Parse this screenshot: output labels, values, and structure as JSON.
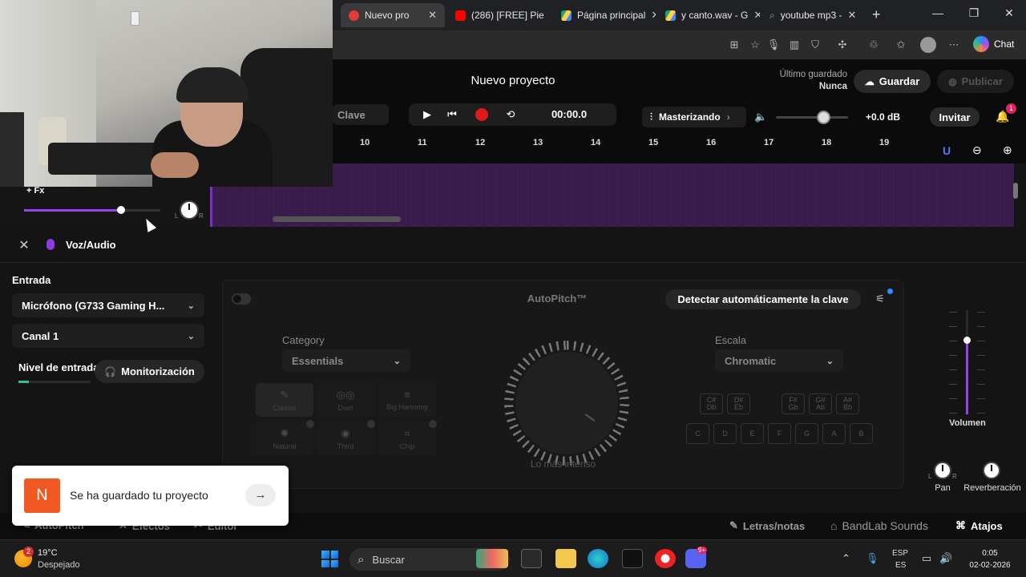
{
  "browser": {
    "tabs": [
      {
        "title": "Nuevo pro",
        "active": true
      },
      {
        "title": "(286) [FREE] Pie"
      },
      {
        "title": "Página principal"
      },
      {
        "title": "y canto.wav - G"
      },
      {
        "title": "youtube mp3 -"
      }
    ],
    "new_tab": "+",
    "chat_label": "Chat",
    "window": {
      "minimize": "—",
      "maximize": "❐",
      "close": "✕"
    }
  },
  "header": {
    "project_title": "Nuevo proyecto",
    "last_saved_label": "Último guardado",
    "last_saved_value": "Nunca",
    "save_label": "Guardar",
    "publish_label": "Publicar"
  },
  "transport": {
    "key_label": "Clave",
    "time": "00:00.0",
    "mastering_label": "Masterizando",
    "master_db": "+0.0 dB",
    "invite_label": "Invitar",
    "notifications_count": "1"
  },
  "ruler": {
    "ticks": [
      "10",
      "11",
      "12",
      "13",
      "14",
      "15",
      "16",
      "17",
      "18",
      "19"
    ]
  },
  "track": {
    "fx_label": "+ Fx",
    "knob_left": "L",
    "knob_right": "R"
  },
  "panel": {
    "title": "Voz/Audio",
    "input_label": "Entrada",
    "input_device": "Micrófono (G733 Gaming H...",
    "channel": "Canal 1",
    "input_level_label": "Nivel de entrada",
    "monitor_label": "Monitorización"
  },
  "autopitch": {
    "title": "AutoPitch™",
    "detect_key_label": "Detectar automáticamente la clave",
    "category_label": "Category",
    "category_value": "Essentials",
    "scale_label": "Escala",
    "scale_value": "Chromatic",
    "presets": [
      "Classic",
      "Duet",
      "Big Harmony",
      "Natural",
      "Third",
      "Chip"
    ],
    "dial_label": "Lo más intenso",
    "sharp_keys": [
      "C#\nDb",
      "D#\nEb",
      "F#\nGb",
      "G#\nAb",
      "A#\nBb"
    ],
    "natural_keys": [
      "C",
      "D",
      "E",
      "F",
      "G",
      "A",
      "B"
    ]
  },
  "mixer": {
    "volume_label": "Volumen",
    "pan_label": "Pan",
    "reverb_label": "Reverberación",
    "pan_left": "L",
    "pan_right": "R"
  },
  "bottom_bar": {
    "tabs": [
      "AutoPitch",
      "Efectos",
      "Editor"
    ],
    "lyrics_label": "Letras/notas",
    "sounds_label": "BandLab Sounds",
    "shortcuts_label": "Atajos"
  },
  "toast": {
    "logo": "N",
    "message": "Se ha guardado tu proyecto",
    "action": "→"
  },
  "taskbar": {
    "weather_badge": "2",
    "temperature": "19°C",
    "condition": "Despejado",
    "search_placeholder": "Buscar",
    "lang1": "ESP",
    "lang2": "ES",
    "time": "0:05",
    "date": "02-02-2026",
    "discord_badge": "9+"
  },
  "colors": {
    "accent": "#9c3ff0",
    "record": "#e2191a",
    "brand": "#f05a22"
  }
}
